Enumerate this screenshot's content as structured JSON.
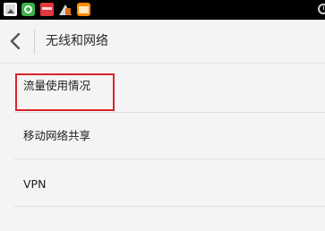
{
  "status_bar": {
    "icons": [
      "image-notification-icon",
      "360-security-icon",
      "sms-icon",
      "tools-icon",
      "calendar-icon",
      "alarm-icon"
    ]
  },
  "header": {
    "title": "无线和网络"
  },
  "settings_list": {
    "items": [
      {
        "label": "流量使用情况"
      },
      {
        "label": "移动网络共享"
      },
      {
        "label": "VPN"
      }
    ]
  },
  "colors": {
    "background": "#f4f4f4",
    "status_bar": "#000000",
    "highlight": "#d9242b",
    "divider": "#dedede"
  }
}
